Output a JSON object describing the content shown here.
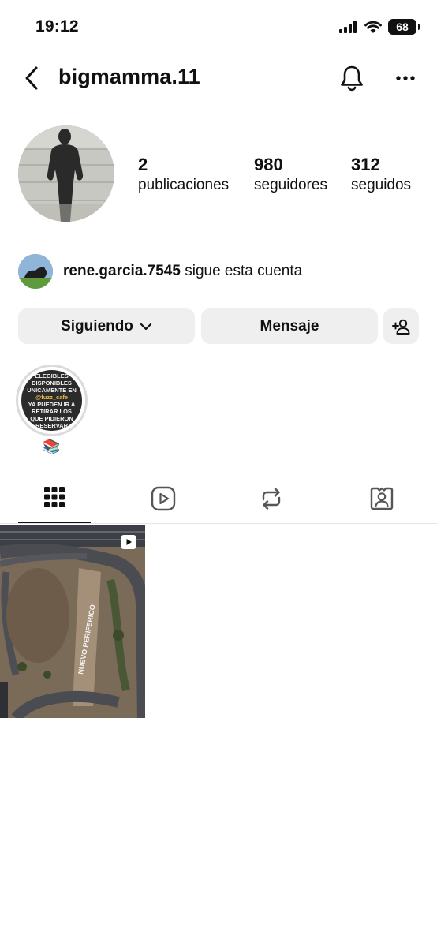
{
  "status_bar": {
    "time": "19:12",
    "battery": "68"
  },
  "header": {
    "username": "bigmamma.11",
    "icons": [
      "back-chevron-icon",
      "bell-icon",
      "more-icon"
    ]
  },
  "profile": {
    "stats": [
      {
        "value": "2",
        "label": "publicaciones"
      },
      {
        "value": "980",
        "label": "seguidores"
      },
      {
        "value": "312",
        "label": "seguidos"
      }
    ],
    "followed_by": {
      "username": "rene.garcia.7545",
      "suffix": "sigue esta cuenta"
    }
  },
  "actions": {
    "following": "Siguiendo",
    "message": "Mensaje"
  },
  "highlights": [
    {
      "label": "📚",
      "cover_text": [
        "ELEGIBLES",
        "DISPONIBLES",
        "UNICAMENTE EN",
        "@fuzz_cafe",
        "YA PUEDEN IR A",
        "RETIRAR LOS",
        "QUE PIDIERON",
        "RESERVAR"
      ]
    }
  ],
  "tabs": [
    "grid-icon",
    "reels-icon",
    "reposts-icon",
    "tagged-icon"
  ],
  "posts": [
    {
      "type": "reel",
      "road_label": "NUEVO PERIFERICO"
    }
  ],
  "colors": {
    "text": "#111111",
    "button_bg": "#efefef",
    "divider": "#e6e6e6",
    "highlight_accent": "#e8b84a"
  }
}
